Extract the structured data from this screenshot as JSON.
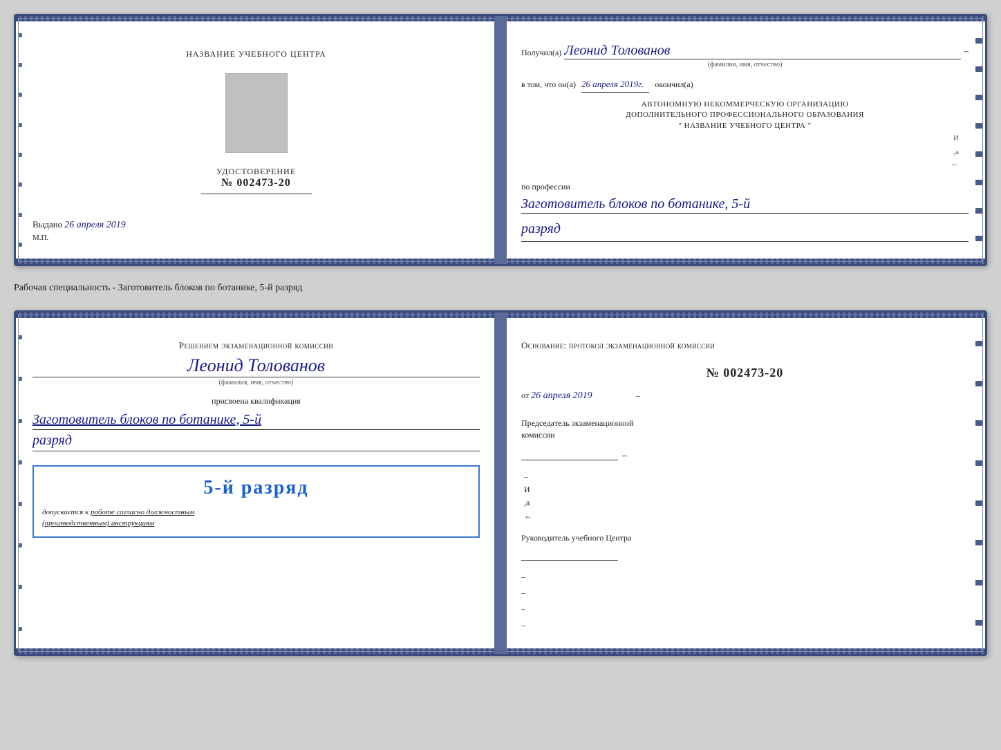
{
  "top_card": {
    "left": {
      "title": "НАЗВАНИЕ УЧЕБНОГО ЦЕНТРА",
      "udostoverenie_label": "УДОСТОВЕРЕНИЕ",
      "number": "№ 002473-20",
      "vydano_label": "Выдано",
      "vydano_date": "26 апреля 2019",
      "mp_label": "М.П."
    },
    "right": {
      "poluchil_label": "Получил(а)",
      "poluchil_name": "Леонид Толованов",
      "fio_sub": "(фамилия, имя, отчество)",
      "dash": "–",
      "vtom_label": "в том, что он(а)",
      "vtom_date": "26 апреля 2019г.",
      "okonchil": "окончил(а)",
      "block_line1": "АВТОНОМНУЮ НЕКОММЕРЧЕСКУЮ ОРГАНИЗАЦИЮ",
      "block_line2": "ДОПОЛНИТЕЛЬНОГО ПРОФЕССИОНАЛЬНОГО ОБРАЗОВАНИЯ",
      "block_line3": "\"   НАЗВАНИЕ УЧЕБНОГО ЦЕНТРА   \"",
      "po_professii": "по профессии",
      "profession": "Заготовитель блоков по ботанике, 5-й",
      "razryad": "разряд"
    }
  },
  "middle": {
    "label": "Рабочая специальность - Заготовитель блоков по ботанике, 5-й разряд"
  },
  "bottom_card": {
    "left": {
      "resheniyem": "Решением экзаменационной комиссии",
      "person_name": "Леонид Толованов",
      "fio_sub": "(фамилия, имя, отчество)",
      "prisvoena": "присвоена квалификация",
      "qualification": "Заготовитель блоков по ботанике, 5-й",
      "razryad": "разряд",
      "stamp_number": "5-й разряд",
      "stamp_sub": "допускается к  работе согласно должностным\n(производственным) инструкциям"
    },
    "right": {
      "osnovanie": "Основание: протокол экзаменационной комиссии",
      "protokol_number": "№  002473-20",
      "ot_label": "от",
      "ot_date": "26 апреля 2019",
      "predsedatel_label": "Председатель экзаменационной\nкомиссии",
      "rukovoditel_label": "Руководитель учебного\nЦентра"
    }
  }
}
